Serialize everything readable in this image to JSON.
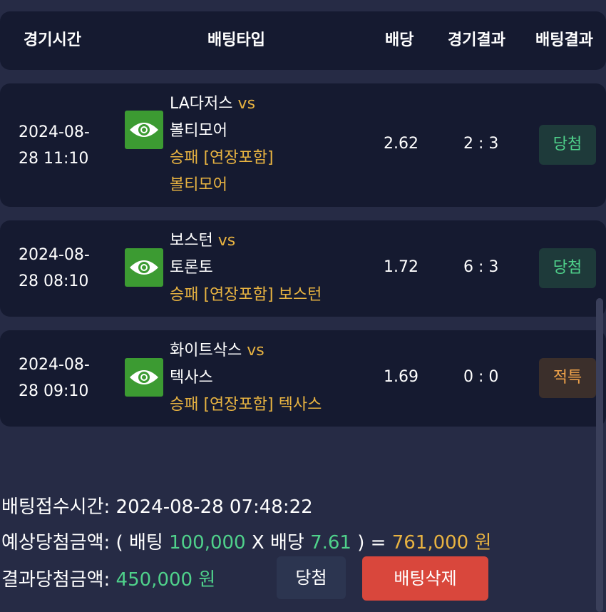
{
  "header": {
    "time": "경기시간",
    "bet_type": "배팅타입",
    "odds": "배당",
    "result": "경기결과",
    "bet_result": "배팅결과"
  },
  "bets": [
    {
      "date": "2024-08-",
      "time": "28 11:10",
      "home": "LA다저스",
      "vs": "vs",
      "away": "볼티모어",
      "pick_line1": "승패 [연장포함]",
      "pick_line2": "볼티모어",
      "odds": "2.62",
      "score": "2 : 3",
      "result": "당첨"
    },
    {
      "date": "2024-08-",
      "time": "28 08:10",
      "home": "보스턴",
      "vs": "vs",
      "away": "토론토",
      "pick": "승패 [연장포함] 보스턴",
      "odds": "1.72",
      "score": "6 : 3",
      "result": "당첨"
    },
    {
      "date": "2024-08-",
      "time": "28 09:10",
      "home": "화이트삭스",
      "vs": "vs",
      "away": "텍사스",
      "pick": "승패 [연장포함] 텍사스",
      "odds": "1.69",
      "score": "0 : 0",
      "result": "적특"
    }
  ],
  "summary": {
    "received_label": "배팅접수시간:",
    "received_value": "2024-08-28 07:48:22",
    "expected_label": "예상당첨금액:",
    "open_paren": "(",
    "bet_label": "배팅",
    "bet_amount": "100,000",
    "times": "X",
    "odds_label": "배당",
    "odds_value": "7.61",
    "close_eq": ") =",
    "expected_amount": "761,000 원",
    "result_label": "결과당첨금액:",
    "result_amount": "450,000 원"
  },
  "buttons": {
    "win": "당첨",
    "delete": "배팅삭제"
  },
  "colors": {
    "background": "#262b45",
    "card": "#151a30",
    "gold": "#e8b341",
    "green": "#4fd18b",
    "eye_button": "#3c9b32",
    "delete_button": "#d9473c"
  },
  "icons": {
    "detail": "eye-icon"
  }
}
